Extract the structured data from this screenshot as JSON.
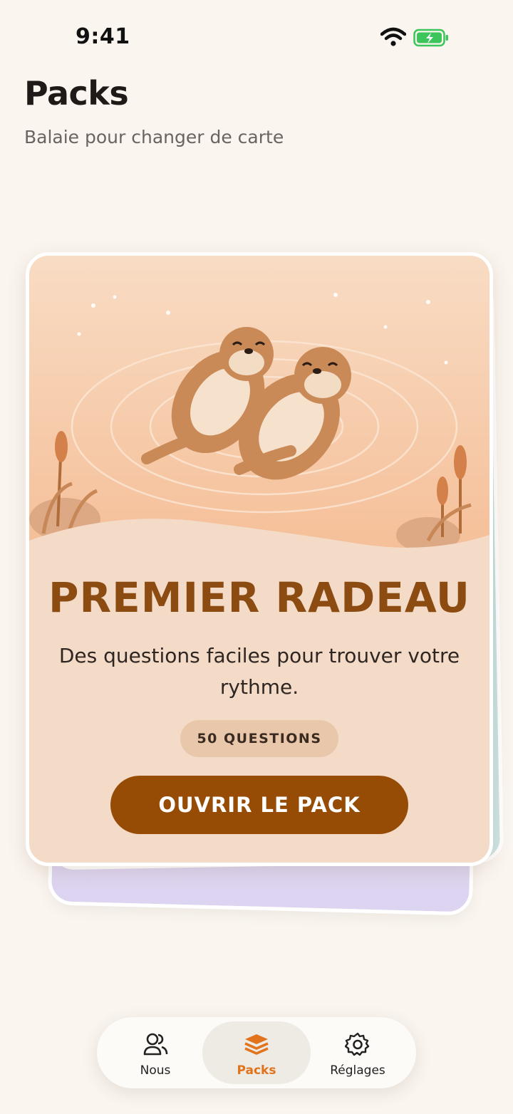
{
  "status_bar": {
    "time": "9:41"
  },
  "header": {
    "title": "Packs",
    "subtitle": "Balaie pour changer de carte"
  },
  "card": {
    "title": "PREMIER RADEAU",
    "description": "Des questions faciles pour trouver votre rythme.",
    "badge": "50 QUESTIONS",
    "button_label": "OUVRIR LE PACK",
    "accent_color": "#8c4b10",
    "button_color": "#974c06"
  },
  "tab_bar": {
    "tabs": [
      {
        "label": "Nous",
        "icon": "people-icon",
        "active": false
      },
      {
        "label": "Packs",
        "icon": "stack-icon",
        "active": true
      },
      {
        "label": "Réglages",
        "icon": "gear-icon",
        "active": false
      }
    ],
    "active_color": "#e0731c"
  }
}
